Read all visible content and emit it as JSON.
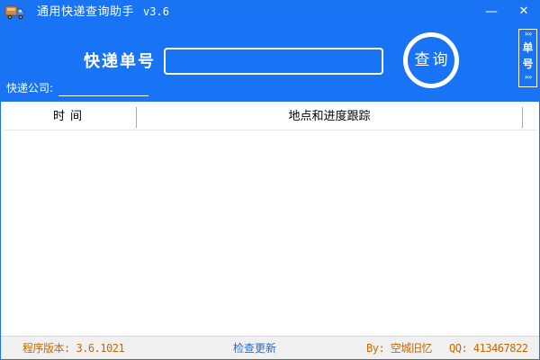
{
  "window": {
    "title": "通用快递查询助手",
    "version": "v3.6",
    "minimize_glyph": "—",
    "close_glyph": "✕",
    "icon": "delivery-truck-icon"
  },
  "search": {
    "label": "快递单号",
    "value": "",
    "button_label": "查询",
    "side_tab_label_1": "单",
    "side_tab_label_2": "号",
    "side_tab_chevron": "»»",
    "company_label": "快递公司:",
    "company_value": ""
  },
  "table": {
    "columns": [
      "时间",
      "地点和进度跟踪"
    ],
    "rows": []
  },
  "footer": {
    "version_text": "程序版本: 3.6.1021",
    "update_link": "检查更新",
    "author_text": "By: 空城旧忆",
    "qq_text": "QQ: 413467822"
  },
  "colors": {
    "header_bg": "#1873f5",
    "accent_text": "#c46a00",
    "link": "#1a6fd6"
  }
}
